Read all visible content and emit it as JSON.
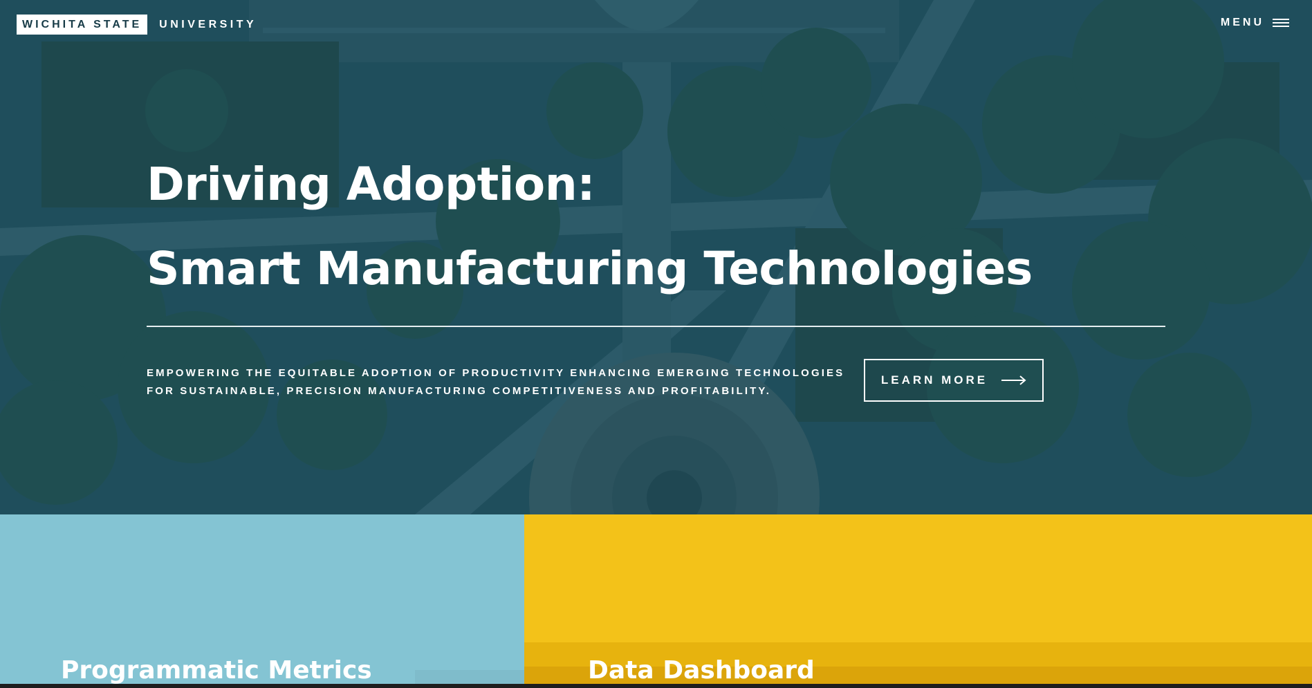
{
  "header": {
    "brand_box": "WICHITA STATE",
    "brand_word": "UNIVERSITY",
    "menu_label": "MENU",
    "menu_icon": "hamburger-icon"
  },
  "hero": {
    "headline_line1": "Driving Adoption:",
    "headline_line2": "Smart Manufacturing Technologies",
    "tagline": "Empowering the equitable adoption of productivity enhancing emerging technologies for sustainable, precision manufacturing competitiveness and profitability.",
    "cta_label": "LEARN MORE",
    "cta_icon": "arrow-right-icon"
  },
  "panels": [
    {
      "title": "Programmatic Metrics",
      "color": "#84c4d3"
    },
    {
      "title": "Data Dashboard",
      "color": "#f3c219"
    }
  ],
  "colors": {
    "hero_overlay": "#1c4a57",
    "brand_text": "#173b47",
    "white": "#ffffff"
  }
}
